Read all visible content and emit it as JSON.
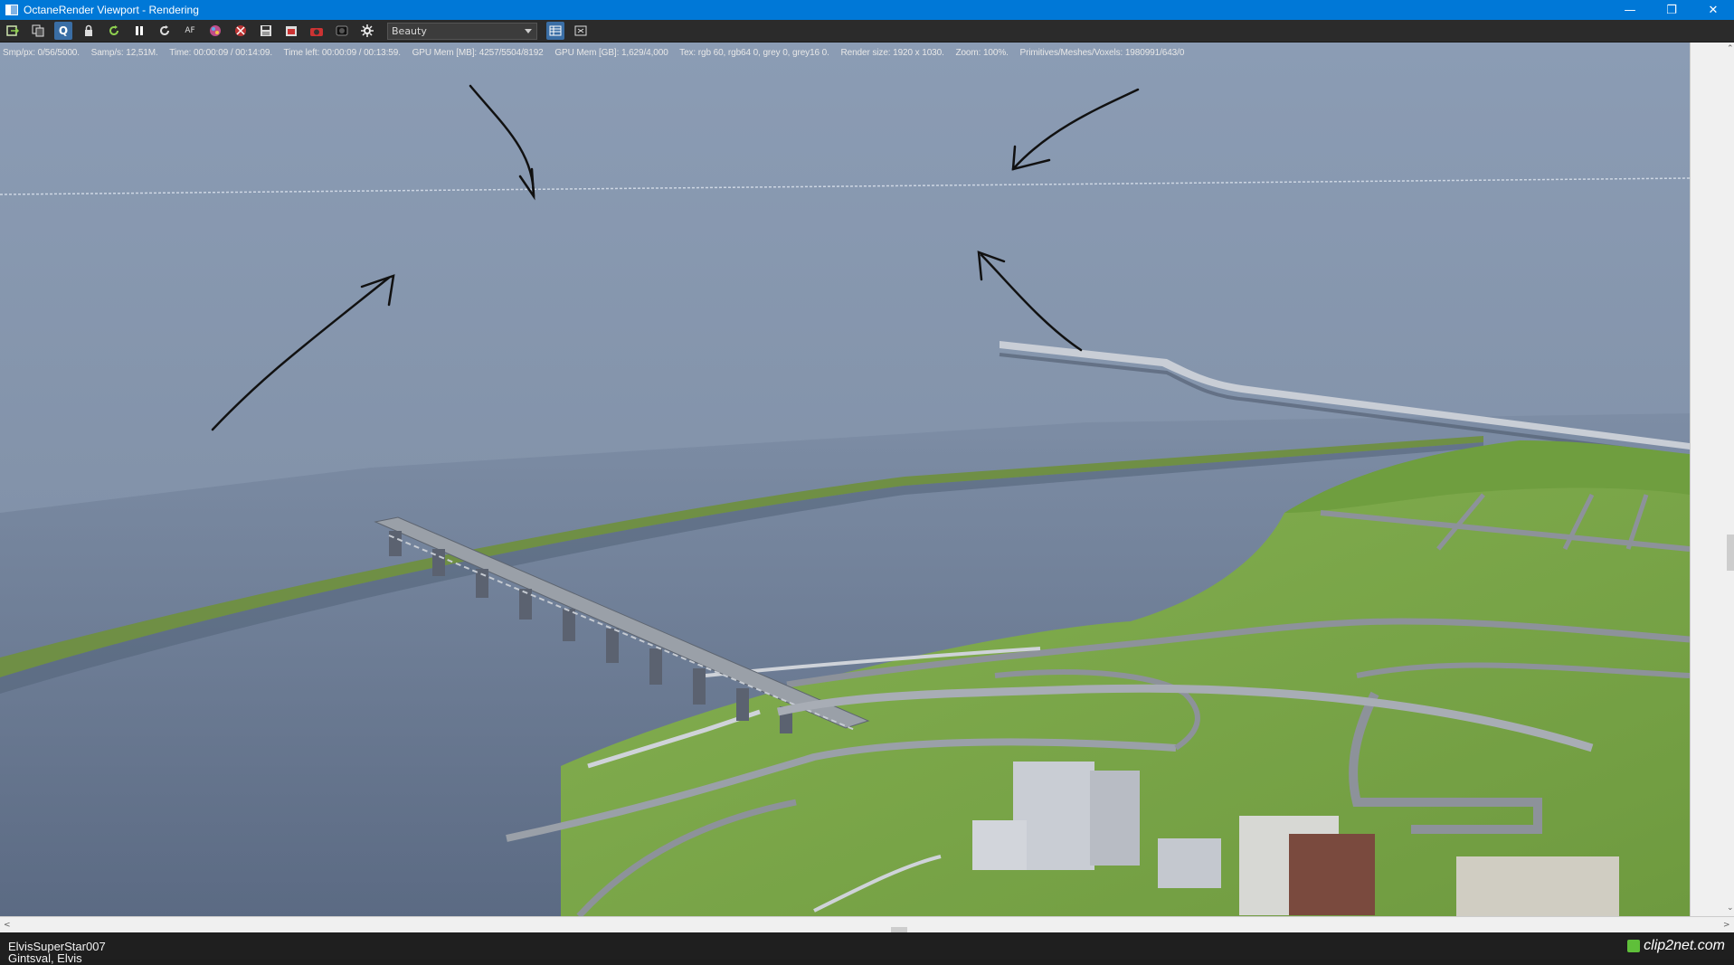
{
  "window": {
    "title": "OctaneRender Viewport - Rendering",
    "controls": {
      "minimize": "—",
      "restore": "❐",
      "close": "✕"
    }
  },
  "toolbar": {
    "buttons": [
      {
        "name": "send-scene-icon"
      },
      {
        "name": "copy-icon"
      },
      {
        "name": "region-render-icon",
        "glyph": "Q",
        "active": true
      },
      {
        "name": "lock-icon"
      },
      {
        "name": "reset-render-icon"
      },
      {
        "name": "pause-icon"
      },
      {
        "name": "restart-icon"
      },
      {
        "name": "focus-picker-icon",
        "glyph": "AF"
      },
      {
        "name": "color-picker-icon"
      },
      {
        "name": "material-picker-icon"
      },
      {
        "name": "save-image-icon"
      },
      {
        "name": "film-settings-icon"
      },
      {
        "name": "camera-icon"
      },
      {
        "name": "render-settings-icon"
      },
      {
        "name": "gear-icon"
      }
    ],
    "render_pass": "Beauty",
    "right_buttons": [
      {
        "name": "viewport-mode-icon",
        "active": true
      },
      {
        "name": "fit-view-icon"
      }
    ]
  },
  "stats": {
    "smp": "Smp/px: 0/56/5000.",
    "samps": "Samp/s: 12,51M.",
    "time": "Time: 00:00:09 / 00:14:09.",
    "time_left": "Time left: 00:00:09 / 00:13:59.",
    "gpu_mem_mb": "GPU Mem [MB]: 4257/5504/8192",
    "gpu_mem_gb": "GPU Mem [GB]: 1,629/4,000",
    "tex": "Tex: rgb 60, rgb64 0, grey 0, grey16 0.",
    "render_size": "Render size: 1920 x 1030.",
    "zoom": "Zoom: 100%.",
    "primitives": "Primitives/Meshes/Voxels: 1980991/643/0"
  },
  "scroll": {
    "up": "⌃",
    "down": "⌄",
    "left": "<",
    "right": ">"
  },
  "statusbar": {
    "user": "ElvisSuperStar007",
    "name": "Gintsval, Elvis"
  },
  "watermark": {
    "text": "clip2net.com"
  },
  "colors": {
    "titlebar": "#0078d7",
    "sky_top": "#8a9bb3",
    "sky_horizon": "#7f8fa6",
    "water": "#5d6e88",
    "grass": "#7aa84a",
    "road": "#8d929a"
  }
}
